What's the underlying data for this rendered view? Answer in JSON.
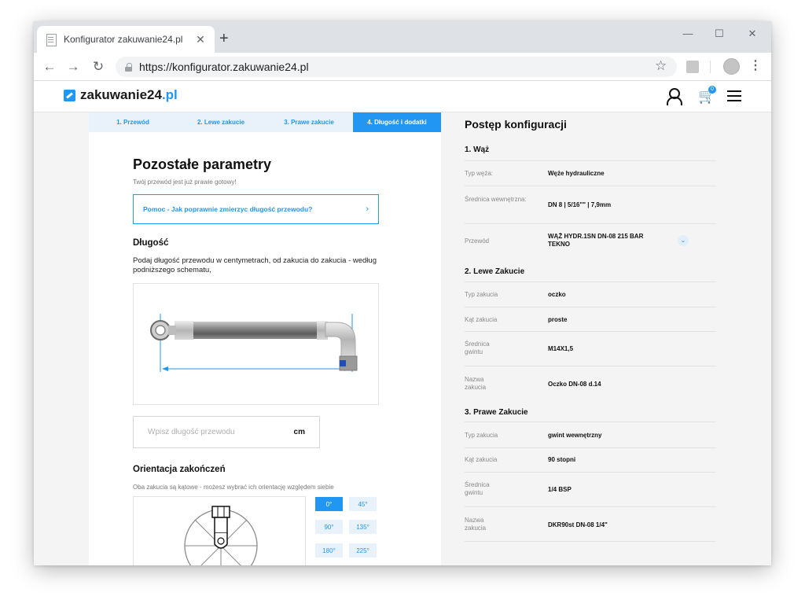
{
  "browser": {
    "tab_title": "Konfigurator zakuwanie24.pl",
    "tab_close": "✕",
    "new_tab": "+",
    "url": "https://konfigurator.zakuwanie24.pl",
    "back": "←",
    "forward": "→",
    "reload": "↻",
    "bookmark": "☆",
    "menu": "⋮",
    "minimize": "—",
    "maximize": "☐",
    "close": "✕"
  },
  "site": {
    "logo_text": "zakuwanie24",
    "logo_accent": ".pl",
    "cart_icon": "🛒",
    "cart_count": "0",
    "brand_color": "#2196f3"
  },
  "steps": [
    {
      "label": "1. Przewód"
    },
    {
      "label": "2. Lewe zakucie"
    },
    {
      "label": "3. Prawe zakucie"
    },
    {
      "label": "4. Długość i dodatki"
    }
  ],
  "main": {
    "title": "Pozostałe parametry",
    "subtitle": "Twój przewód jest już prawie gotowy!",
    "help_label": "Pomoc - Jak poprawnie zmierzyc długość przewodu?",
    "help_arrow": "›",
    "length_title": "Długość",
    "length_desc": "Podaj długość przewodu w centymetrach, od zakucia do zakucia - według podniższego schematu,",
    "length_placeholder": "Wpisz długość przewodu",
    "length_unit": "cm",
    "orient_title": "Orientacja zakończeń",
    "orient_desc": "Oba zakucia są kątowe - możesz wybrać ich orientację względem siebie",
    "angles": [
      "0°",
      "45°",
      "90°",
      "135°",
      "180°",
      "225°"
    ],
    "selected_angle": "0°"
  },
  "summary": {
    "title": "Postęp konfiguracji",
    "sections": [
      {
        "heading": "1. Wąż",
        "rows": [
          {
            "label": "Typ węża:",
            "value": "Węże hydrauliczne"
          },
          {
            "label": "Średnica wewnętrzna:",
            "value": "DN 8 | 5/16\"\" | 7,9mm"
          },
          {
            "label": "Przewód",
            "value": "WĄŻ HYDR.1SN DN-08 215 BAR TEKNO",
            "expand": "⌄"
          }
        ]
      },
      {
        "heading": "2. Lewe Zakucie",
        "rows": [
          {
            "label": "Typ zakucia",
            "value": "oczko"
          },
          {
            "label": "Kąt zakucia",
            "value": "proste"
          },
          {
            "label": "Średnica gwintu",
            "value": "M14X1,5"
          },
          {
            "label": "Nazwa zakucia",
            "value": "Oczko DN-08 d.14"
          }
        ]
      },
      {
        "heading": "3. Prawe Zakucie",
        "rows": [
          {
            "label": "Typ zakucia",
            "value": "gwint wewnętrzny"
          },
          {
            "label": "Kąt zakucia",
            "value": "90 stopni"
          },
          {
            "label": "Średnica gwintu",
            "value": "1/4 BSP"
          },
          {
            "label": "Nazwa zakucia",
            "value": "DKR90st DN-08 1/4\""
          }
        ]
      }
    ]
  }
}
